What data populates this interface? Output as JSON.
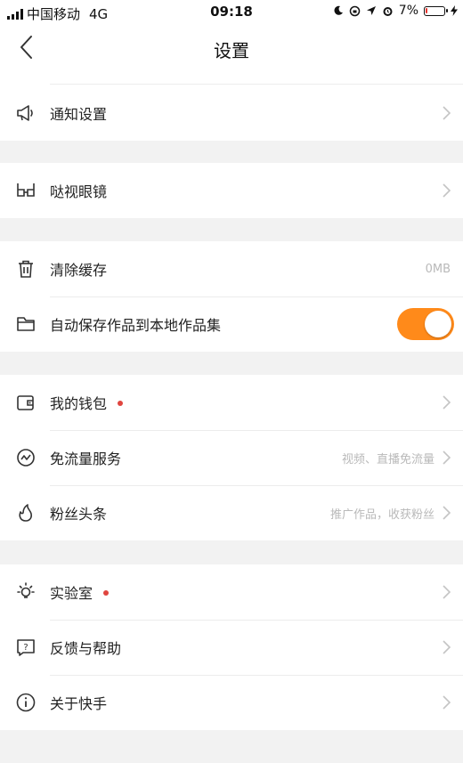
{
  "status_bar": {
    "carrier": "中国移动",
    "network": "4G",
    "time": "09:18",
    "battery_percent": "7%",
    "battery_level": 0.07,
    "battery_color": "#e8322b"
  },
  "header": {
    "title": "设置"
  },
  "accent_color": "#ff8a1a",
  "groups": [
    {
      "items": [
        {
          "label": "通知设置",
          "icon": "megaphone-icon"
        }
      ]
    },
    {
      "items": [
        {
          "label": "哒视眼镜",
          "icon": "glasses-icon"
        }
      ]
    },
    {
      "items": [
        {
          "label": "清除缓存",
          "icon": "trash-icon",
          "value": "0MB"
        },
        {
          "label": "自动保存作品到本地作品集",
          "icon": "folder-icon",
          "toggle": true
        }
      ]
    },
    {
      "items": [
        {
          "label": "我的钱包",
          "icon": "wallet-icon",
          "badge_dot": true
        },
        {
          "label": "免流量服务",
          "icon": "traffic-icon",
          "value": "视频、直播免流量"
        },
        {
          "label": "粉丝头条",
          "icon": "flame-icon",
          "value": "推广作品，收获粉丝"
        }
      ]
    },
    {
      "items": [
        {
          "label": "实验室",
          "icon": "lightbulb-icon",
          "badge_dot": true
        },
        {
          "label": "反馈与帮助",
          "icon": "help-icon"
        },
        {
          "label": "关于快手",
          "icon": "info-icon"
        }
      ]
    }
  ]
}
